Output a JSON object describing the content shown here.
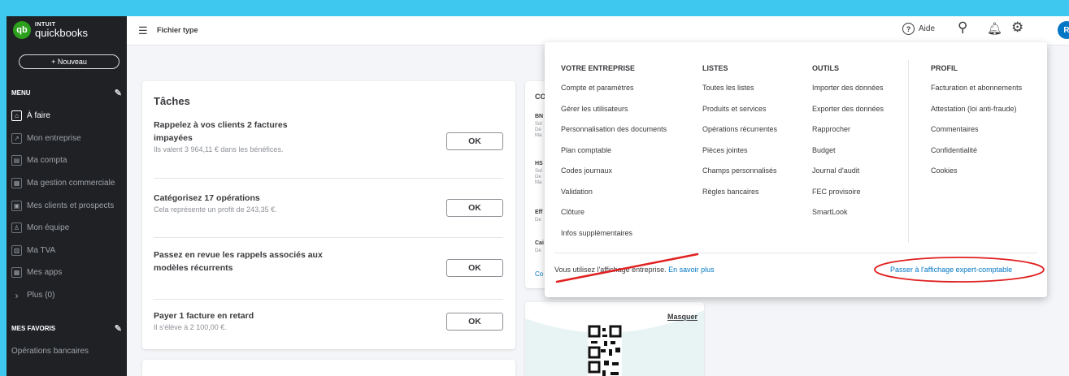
{
  "logo": {
    "mark": "qb",
    "brand": "INTUIT",
    "product": "quickbooks"
  },
  "sidebar": {
    "new_button": "+ Nouveau",
    "menu_heading": "MENU",
    "items": [
      {
        "label": "À faire",
        "icon": "home-icon",
        "glyph": "⌂",
        "active": true
      },
      {
        "label": "Mon entreprise",
        "icon": "chart-icon",
        "glyph": "↗",
        "active": false
      },
      {
        "label": "Ma compta",
        "icon": "ledger-icon",
        "glyph": "▤",
        "active": false
      },
      {
        "label": "Ma gestion commerciale",
        "icon": "commerce-icon",
        "glyph": "▦",
        "active": false
      },
      {
        "label": "Mes clients et prospects",
        "icon": "contacts-icon",
        "glyph": "▣",
        "active": false
      },
      {
        "label": "Mon équipe",
        "icon": "team-icon",
        "glyph": "♙",
        "active": false
      },
      {
        "label": "Ma TVA",
        "icon": "tax-icon",
        "glyph": "▥",
        "active": false
      },
      {
        "label": "Mes apps",
        "icon": "apps-icon",
        "glyph": "▦",
        "active": false
      },
      {
        "label": "Plus (0)",
        "icon": "chevron-right-icon",
        "glyph": "›",
        "active": false
      }
    ],
    "favorites_heading": "MES FAVORIS",
    "favorites": [
      "Opérations bancaires"
    ]
  },
  "header": {
    "company": "Fichier type",
    "help_label": "Aide",
    "avatar_initial": "R"
  },
  "tasks": {
    "title": "Tâches",
    "items": [
      {
        "title": "Rappelez à vos clients 2 factures impayées",
        "sub": "Ils valent 3 964,11 € dans les bénéfices.",
        "button": "OK"
      },
      {
        "title": "Catégorisez 17 opérations",
        "sub": "Cela représente un profit de 243,35 €.",
        "button": "OK"
      },
      {
        "title": "Passez en revue les rappels associés aux modèles récurrents",
        "sub": "",
        "button": "OK"
      },
      {
        "title": "Payer 1 facture en retard",
        "sub": "Il s'élève à 2 100,00 €.",
        "button": "OK"
      }
    ]
  },
  "mid_card": {
    "heading": "CO",
    "rows": [
      {
        "bold": "BN",
        "lines": [
          "Sol",
          "De",
          "Ma"
        ]
      },
      {
        "bold": "HS",
        "lines": [
          "Sol",
          "De",
          "Ma"
        ]
      },
      {
        "bold": "Eff",
        "lines": [
          "De"
        ]
      },
      {
        "bold": "Cai",
        "lines": [
          "De"
        ]
      }
    ],
    "link": "Co"
  },
  "qr_card": {
    "hide_label": "Masquer"
  },
  "settings_menu": {
    "columns": [
      {
        "heading": "VOTRE ENTREPRISE",
        "items": [
          "Compte et paramètres",
          "Gérer les utilisateurs",
          "Personnalisation des documents",
          "Plan comptable",
          "Codes journaux",
          "Validation",
          "Clôture",
          "Infos supplémentaires"
        ]
      },
      {
        "heading": "LISTES",
        "items": [
          "Toutes les listes",
          "Produits et services",
          "Opérations récurrentes",
          "Pièces jointes",
          "Champs personnalisés",
          "Règles bancaires"
        ]
      },
      {
        "heading": "OUTILS",
        "items": [
          "Importer des données",
          "Exporter des données",
          "Rapprocher",
          "Budget",
          "Journal d'audit",
          "FEC provisoire",
          "SmartLook"
        ]
      },
      {
        "heading": "PROFIL",
        "items": [
          "Facturation et abonnements",
          "Attestation (loi anti-fraude)",
          "Commentaires",
          "Confidentialité",
          "Cookies"
        ]
      }
    ],
    "footer_text": "Vous utilisez l'affichage entreprise.",
    "footer_link": "En savoir plus",
    "switch_link": "Passer à l'affichage expert-comptable"
  },
  "colors": {
    "accent_green": "#2ca01c",
    "link_blue": "#0077c5",
    "sidebar_bg": "#1f2124",
    "annotation_red": "#e02020",
    "backdrop": "#3ec7ef"
  }
}
